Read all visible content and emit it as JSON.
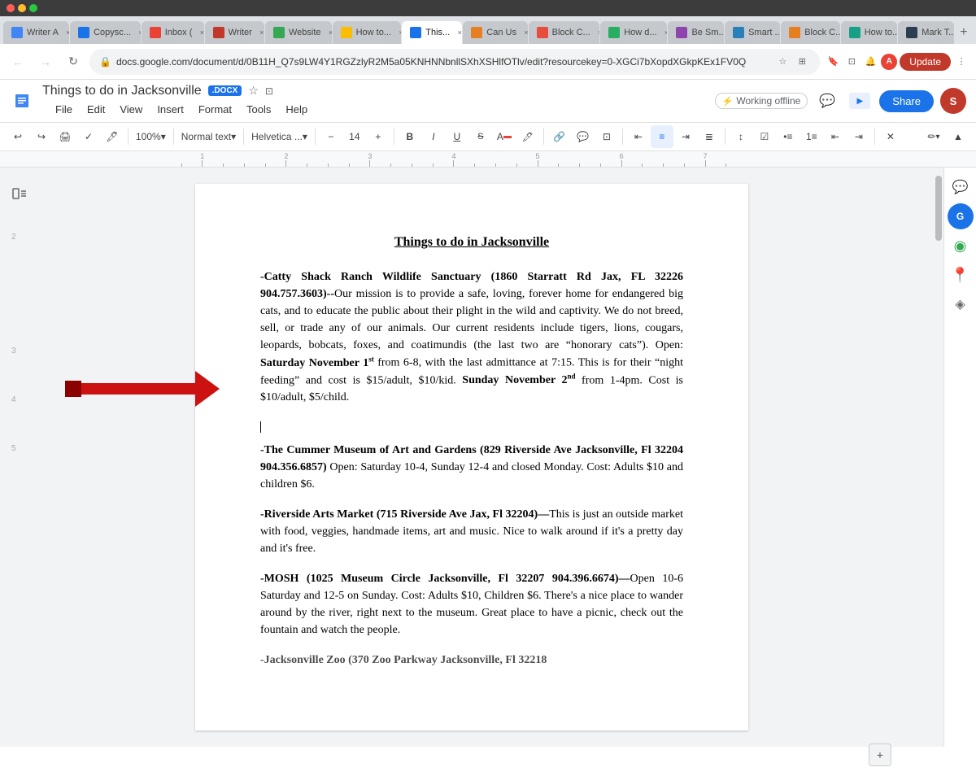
{
  "browser": {
    "tabs": [
      {
        "id": "writer1",
        "label": "Writer A",
        "favicon_color": "#4285f4",
        "active": false
      },
      {
        "id": "copyscape",
        "label": "Copysc...",
        "favicon_color": "#1a73e8",
        "active": false
      },
      {
        "id": "inbox",
        "label": "Inbox (",
        "favicon_color": "#ea4335",
        "active": false
      },
      {
        "id": "writer2",
        "label": "Writer",
        "favicon_color": "#c0392b",
        "active": false
      },
      {
        "id": "website",
        "label": "Website",
        "favicon_color": "#34a853",
        "active": false
      },
      {
        "id": "howto1",
        "label": "How to...",
        "favicon_color": "#fbbc04",
        "active": false
      },
      {
        "id": "thisis",
        "label": "This...",
        "favicon_color": "#1a73e8",
        "active": true
      },
      {
        "id": "canus",
        "label": "Can Us",
        "favicon_color": "#e67e22",
        "active": false
      },
      {
        "id": "block1",
        "label": "Block C...",
        "favicon_color": "#e74c3c",
        "active": false
      },
      {
        "id": "howdo",
        "label": "How d...",
        "favicon_color": "#27ae60",
        "active": false
      },
      {
        "id": "besm",
        "label": "Be Sm...",
        "favicon_color": "#8e44ad",
        "active": false
      },
      {
        "id": "smart",
        "label": "Smart ...",
        "favicon_color": "#2980b9",
        "active": false
      },
      {
        "id": "block2",
        "label": "Block C...",
        "favicon_color": "#e67e22",
        "active": false
      },
      {
        "id": "howto2",
        "label": "How to...",
        "favicon_color": "#16a085",
        "active": false
      },
      {
        "id": "howto3",
        "label": "How to...",
        "favicon_color": "#8e44ad",
        "active": false
      },
      {
        "id": "mark",
        "label": "Mark T...",
        "favicon_color": "#2c3e50",
        "active": false
      }
    ],
    "address_bar": {
      "url": "docs.google.com/document/d/0B11H_Q7s9LW4Y1RGZzlyR2M5a05KNHNNbnllSXhXSHlfOTlv/edit?resourcekey=0-XGCi7bXopdXGkpKEx1FV0Q",
      "lock_icon": "🔒"
    },
    "update_button": "Update"
  },
  "gdocs": {
    "logo_icon": "≡",
    "title": "Things to do in Jacksonville",
    "docx_badge": ".DOCX",
    "offline_text": "Working offline",
    "star_icon": "☆",
    "move_icon": "⊡",
    "menu": [
      "File",
      "Edit",
      "View",
      "Insert",
      "Format",
      "Tools",
      "Help"
    ],
    "toolbar": {
      "undo_label": "↩",
      "redo_label": "↪",
      "print_label": "🖨",
      "paint_label": "⚙",
      "zoom_value": "100%",
      "paragraph_style": "Normal text",
      "font_name": "Helvetica ...",
      "font_size": "14",
      "bold": "B",
      "italic": "I",
      "underline": "U",
      "strikethrough": "S",
      "text_color": "A",
      "link": "🔗",
      "comment": "💬",
      "image": "⊡",
      "align_left": "≡",
      "align_center": "≡",
      "align_right": "≡",
      "align_justify": "≡",
      "line_spacing": "↕",
      "checklist": "☑",
      "bullets": "•≡",
      "numbered": "1≡",
      "indent_dec": "⇤",
      "indent_inc": "⇥",
      "clear_format": "✕"
    },
    "share_label": "Share",
    "comments_icon": "💬",
    "editing_mode": "✏"
  },
  "document": {
    "title": "Things to do in Jacksonville",
    "sections": [
      {
        "id": "catty",
        "bold_lead": "-Catty Shack Ranch Wildlife Sanctuary (1860 Starratt Rd Jax, FL 32226 904.757.3603)--",
        "text": "Our mission is to provide a safe, loving, forever home for endangered big cats, and to educate the public about their plight in the wild and captivity. We do not breed, sell, or trade any of our animals. Our current residents include tigers, lions, cougars, leopards, bobcats, foxes, and coatimundis (the last two are \"honorary cats\").  Open: ",
        "bold_inline1": "Saturday November 1",
        "sup1": "st",
        "text2": " from 6-8, with the last admittance at 7:15. This is for their \"night feeding\" and cost is $15/adult, $10/kid.  ",
        "bold_inline2": "Sunday November 2",
        "sup2": "nd",
        "text3": " from 1-4pm. Cost is $10/adult, $5/child."
      },
      {
        "id": "cummer",
        "bold_lead": "-The Cummer Museum of Art and Gardens (829 Riverside Ave Jacksonville, Fl 32204 904.356.6857)",
        "text": " Open: Saturday 10-4, Sunday 12-4 and closed Monday.  Cost: Adults $10 and children $6."
      },
      {
        "id": "riverside",
        "bold_lead": "-Riverside Arts Market (715 Riverside Ave Jax, Fl 32204)—",
        "text": "This is just an outside market with food,  veggies, handmade items, art and music.  Nice to walk around if it's a pretty day and it's free."
      },
      {
        "id": "mosh",
        "bold_lead": "-MOSH (1025 Museum Circle Jacksonville, Fl 32207 904.396.6674)—",
        "text": "Open 10-6 Saturday and 12-5 on Sunday.  Cost: Adults $10, Children $6.  There's a nice place to wander around by the river, right next to the museum.  Great place to have a picnic, check out the fountain and watch the people."
      }
    ]
  },
  "annotation": {
    "arrow_color": "#cc1111",
    "square_color": "#8b0000"
  },
  "right_sidebar": {
    "items": [
      {
        "icon": "💬",
        "color": "none",
        "label": "comments-icon"
      },
      {
        "icon": "G",
        "color": "blue",
        "label": "google-icon"
      },
      {
        "icon": "◉",
        "color": "none",
        "label": "circle-icon"
      },
      {
        "icon": "M",
        "color": "red",
        "label": "maps-icon"
      },
      {
        "icon": "◈",
        "color": "none",
        "label": "diamond-icon"
      }
    ]
  }
}
